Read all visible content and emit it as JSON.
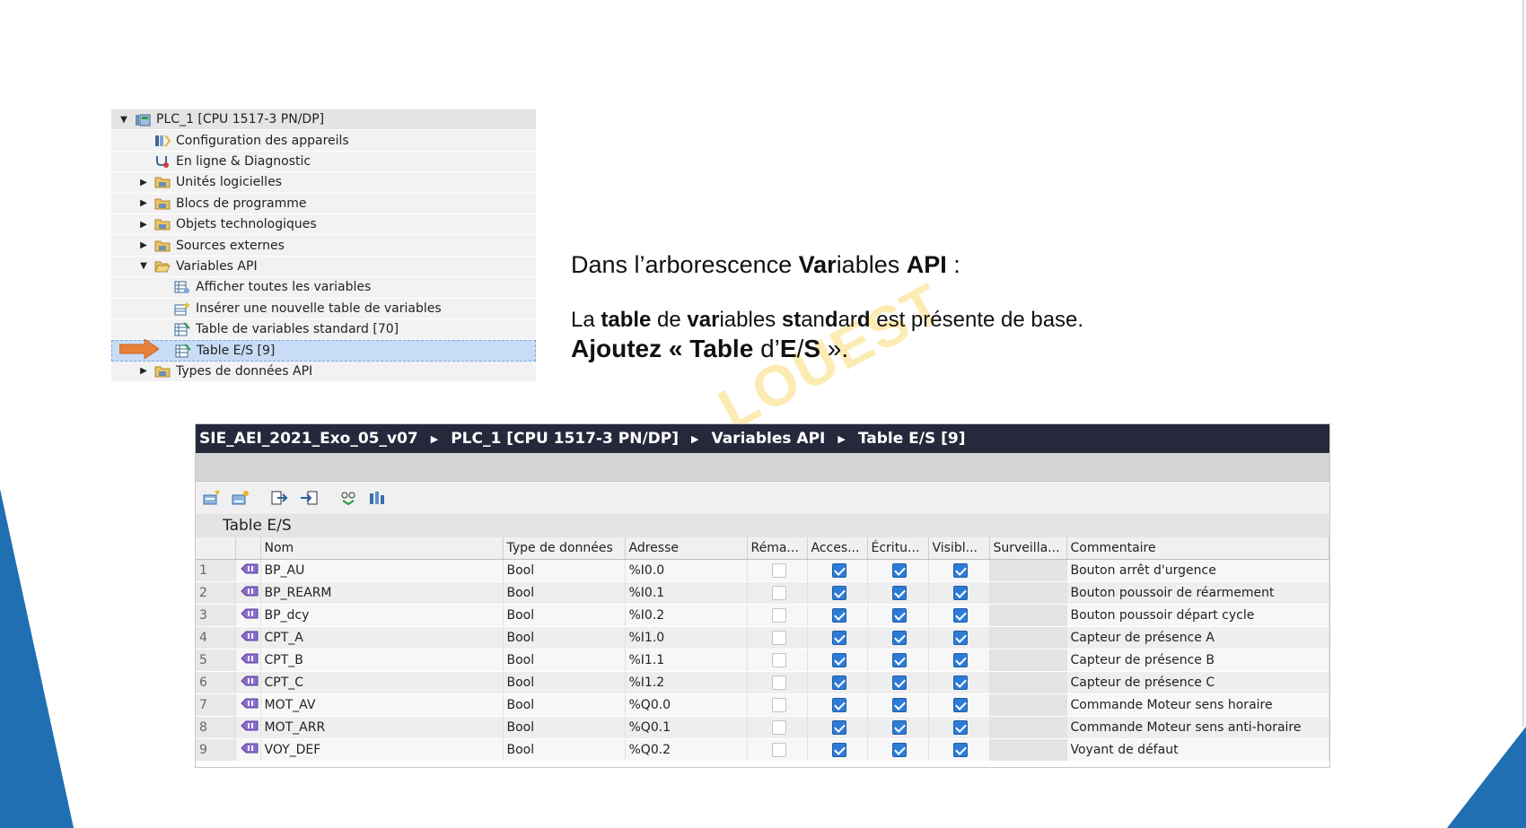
{
  "tree": {
    "items": [
      {
        "label": "PLC_1 [CPU 1517-3 PN/DP]",
        "toggle": "expanded",
        "icon": "plc-icon"
      },
      {
        "label": "Configuration des appareils",
        "toggle": "none",
        "icon": "device-config-icon"
      },
      {
        "label": "En ligne & Diagnostic",
        "toggle": "none",
        "icon": "diagnostic-icon"
      },
      {
        "label": "Unités logicielles",
        "toggle": "collapsed",
        "icon": "folder-icon"
      },
      {
        "label": "Blocs de programme",
        "toggle": "collapsed",
        "icon": "folder-icon"
      },
      {
        "label": "Objets technologiques",
        "toggle": "collapsed",
        "icon": "folder-icon"
      },
      {
        "label": "Sources externes",
        "toggle": "collapsed",
        "icon": "folder-icon"
      },
      {
        "label": "Variables API",
        "toggle": "expanded",
        "icon": "folder-open-icon"
      },
      {
        "label": "Afficher toutes les variables",
        "toggle": "none",
        "icon": "show-variables-icon"
      },
      {
        "label": "Insérer une nouvelle table de variables",
        "toggle": "none",
        "icon": "insert-table-icon"
      },
      {
        "label": "Table de variables standard [70]",
        "toggle": "none",
        "icon": "variable-table-icon"
      },
      {
        "label": "Table E/S [9]",
        "toggle": "none",
        "icon": "variable-table-icon",
        "selected": true
      },
      {
        "label": "Types de données API",
        "toggle": "collapsed",
        "icon": "folder-icon"
      }
    ]
  },
  "instructions": {
    "line1": [
      {
        "text": "Dans l’arborescence ",
        "bold": false
      },
      {
        "text": "Var",
        "bold": true
      },
      {
        "text": "iables ",
        "bold": false
      },
      {
        "text": "API",
        "bold": true
      },
      {
        "text": " :",
        "bold": false
      }
    ],
    "line2": [
      {
        "text": "La ",
        "bold": false
      },
      {
        "text": "table",
        "bold": true
      },
      {
        "text": " de ",
        "bold": false
      },
      {
        "text": "var",
        "bold": true
      },
      {
        "text": "iables ",
        "bold": false
      },
      {
        "text": "st",
        "bold": true
      },
      {
        "text": "an",
        "bold": false
      },
      {
        "text": "d",
        "bold": true
      },
      {
        "text": "ar",
        "bold": false
      },
      {
        "text": "d",
        "bold": true
      },
      {
        "text": " est présente de base.",
        "bold": false
      }
    ],
    "line3": [
      {
        "text": "Ajoutez « ",
        "bold": true
      },
      {
        "text": "Table",
        "bold": true
      },
      {
        "text": " d’",
        "bold": false
      },
      {
        "text": "E",
        "bold": true
      },
      {
        "text": "/",
        "bold": false
      },
      {
        "text": "S",
        "bold": true
      },
      {
        "text": " ».",
        "bold": false
      }
    ]
  },
  "watermark": "LOUEST",
  "editor": {
    "breadcrumb": [
      "SIE_AEI_2021_Exo_05_v07",
      "PLC_1 [CPU 1517-3 PN/DP]",
      "Variables API",
      "Table E/S [9]"
    ],
    "table_title": "Table E/S",
    "columns": [
      "",
      "",
      "Nom",
      "Type de données",
      "Adresse",
      "Réma...",
      "Acces...",
      "Écritu...",
      "Visibl...",
      "Surveilla...",
      "Commentaire"
    ],
    "rows": [
      {
        "num": "1",
        "name": "BP_AU",
        "type": "Bool",
        "address": "%I0.0",
        "retain": false,
        "access": true,
        "write": true,
        "visible": true,
        "comment": "Bouton arrêt d'urgence"
      },
      {
        "num": "2",
        "name": "BP_REARM",
        "type": "Bool",
        "address": "%I0.1",
        "retain": false,
        "access": true,
        "write": true,
        "visible": true,
        "comment": "Bouton poussoir de réarmement"
      },
      {
        "num": "3",
        "name": "BP_dcy",
        "type": "Bool",
        "address": "%I0.2",
        "retain": false,
        "access": true,
        "write": true,
        "visible": true,
        "comment": "Bouton poussoir départ cycle"
      },
      {
        "num": "4",
        "name": "CPT_A",
        "type": "Bool",
        "address": "%I1.0",
        "retain": false,
        "access": true,
        "write": true,
        "visible": true,
        "comment": "Capteur de présence A"
      },
      {
        "num": "5",
        "name": "CPT_B",
        "type": "Bool",
        "address": "%I1.1",
        "retain": false,
        "access": true,
        "write": true,
        "visible": true,
        "comment": "Capteur de présence B"
      },
      {
        "num": "6",
        "name": "CPT_C",
        "type": "Bool",
        "address": "%I1.2",
        "retain": false,
        "access": true,
        "write": true,
        "visible": true,
        "comment": "Capteur de présence C"
      },
      {
        "num": "7",
        "name": "MOT_AV",
        "type": "Bool",
        "address": "%Q0.0",
        "retain": false,
        "access": true,
        "write": true,
        "visible": true,
        "comment": "Commande Moteur sens horaire"
      },
      {
        "num": "8",
        "name": "MOT_ARR",
        "type": "Bool",
        "address": "%Q0.1",
        "retain": false,
        "access": true,
        "write": true,
        "visible": true,
        "comment": "Commande Moteur sens anti-horaire"
      },
      {
        "num": "9",
        "name": "VOY_DEF",
        "type": "Bool",
        "address": "%Q0.2",
        "retain": false,
        "access": true,
        "write": true,
        "visible": true,
        "comment": "Voyant de défaut"
      }
    ]
  },
  "colors": {
    "breadcrumb_bg": "#26283c",
    "accent_blue": "#1f6fb2",
    "arrow_orange": "#e8803a",
    "checkbox_blue": "#2d7bd6",
    "watermark": "#f5c828"
  }
}
